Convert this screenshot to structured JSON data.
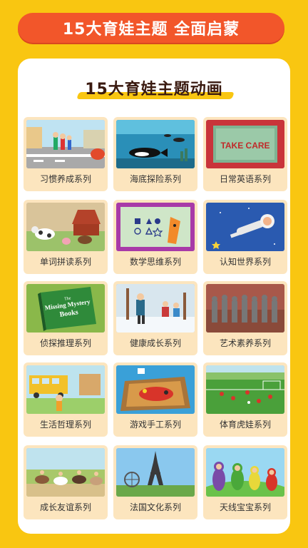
{
  "header": {
    "title": "15大育娃主题 全面启蒙"
  },
  "panel": {
    "title": "15大育娃主题动画"
  },
  "series": [
    {
      "label": "习惯养成系列",
      "icon": "street-cartoon-icon"
    },
    {
      "label": "海底探险系列",
      "icon": "underwater-whale-icon"
    },
    {
      "label": "日常英语系列",
      "icon": "take-care-sign-icon",
      "sign_text": "TAKE CARE"
    },
    {
      "label": "单词拼读系列",
      "icon": "farm-animals-icon"
    },
    {
      "label": "数学思维系列",
      "icon": "math-shapes-icon"
    },
    {
      "label": "认知世界系列",
      "icon": "astronaut-space-icon"
    },
    {
      "label": "侦探推理系列",
      "icon": "mystery-book-icon",
      "book_text": "The Missing Mystery Books"
    },
    {
      "label": "健康成长系列",
      "icon": "winter-kids-icon"
    },
    {
      "label": "艺术素养系列",
      "icon": "terracotta-warriors-icon"
    },
    {
      "label": "生活哲理系列",
      "icon": "school-bus-icon"
    },
    {
      "label": "游戏手工系列",
      "icon": "craft-box-icon"
    },
    {
      "label": "体育虎娃系列",
      "icon": "soccer-field-icon"
    },
    {
      "label": "成长友谊系列",
      "icon": "horse-riding-icon"
    },
    {
      "label": "法国文化系列",
      "icon": "eiffel-tower-icon"
    },
    {
      "label": "天线宝宝系列",
      "icon": "teletubbies-icon"
    }
  ],
  "colors": {
    "background": "#F9C611",
    "banner": "#F2562A",
    "card": "#FCE5BE"
  }
}
